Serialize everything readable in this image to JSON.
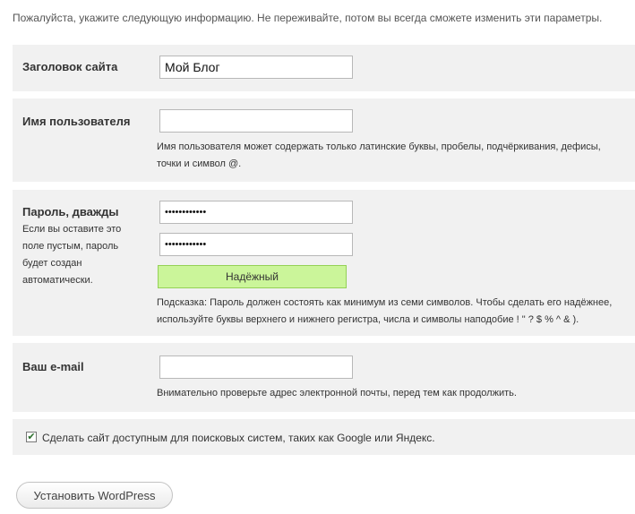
{
  "intro_text": "Пожалуйста, укажите следующую информацию. Не переживайте, потом вы всегда сможете изменить эти параметры.",
  "site_title": {
    "label": "Заголовок сайта",
    "value": "Мой Блог"
  },
  "username": {
    "label": "Имя пользователя",
    "value": "",
    "hint_line1": "Имя пользователя может содержать только латинские буквы, пробелы, подчёркивания, дефисы,",
    "hint_line2": "точки и символ @."
  },
  "password": {
    "label": "Пароль, дважды",
    "note_lines": [
      "Если вы оставите это",
      "поле пустым, пароль",
      "будет создан",
      "автоматически."
    ],
    "value1": "••••••••••••",
    "value2": "••••••••••••",
    "strength": "Надёжный",
    "hint_line1": "Подсказка: Пароль должен состоять как минимум из семи символов. Чтобы сделать его надёжнее,",
    "hint_line2": "используйте буквы верхнего и нижнего регистра, числа и символы наподобие ! \" ? $ % ^ & )."
  },
  "email": {
    "label": "Ваш e-mail",
    "value": "",
    "hint": "Внимательно проверьте адрес электронной почты, перед тем как продолжить."
  },
  "privacy": {
    "checked": true,
    "label": "Сделать сайт доступным для поисковых систем, таких как Google или Яндекс."
  },
  "install_button": "Установить WordPress"
}
